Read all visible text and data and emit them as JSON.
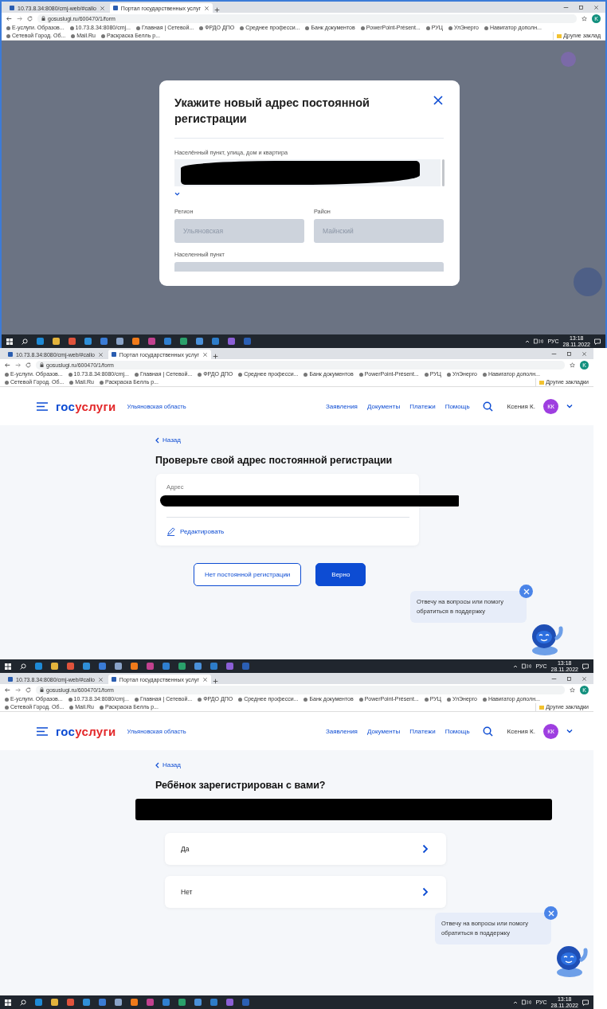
{
  "screens": [
    {
      "kind": "modal",
      "browser": {
        "tabs": [
          {
            "label": "10.73.8.34:8080/cmj-web/#callo",
            "selected": false
          },
          {
            "label": "Портал государственных услуг",
            "selected": true
          }
        ],
        "url": "gosuslugi.ru/600470/1/form",
        "profile_initial": "K",
        "bookmarks": [
          "Е-услуги. Образов...",
          "10.73.8.34:8080/cmj...",
          "Главная | Сетевой...",
          "ФРДО ДПО",
          "Среднее професси...",
          "Банк документов",
          "PowerPoint-Présent...",
          "РУЦ",
          "УлЭнерго",
          "Навигатор дополн...",
          "Сетевой Город. Об...",
          "Mail.Ru",
          "Раскраска Белль р..."
        ],
        "other_bookmarks": "Другие заклад"
      },
      "modal": {
        "title": "Укажите новый адрес постоянной регистрации",
        "address_label": "Населённый пункт, улица, дом и квартира",
        "fields": [
          {
            "label": "Регион",
            "value": "Ульяновская",
            "disabled": true
          },
          {
            "label": "Район",
            "value": "Майнский",
            "disabled": true
          }
        ],
        "locality_label": "Населенный пункт"
      },
      "taskbar": {
        "lang": "РУС",
        "time": "13:18",
        "date": "28.11.2022"
      }
    },
    {
      "kind": "address_check",
      "browser": {
        "tabs": [
          {
            "label": "10.73.8.34:8080/cmj-web/#callo",
            "selected": false
          },
          {
            "label": "Портал государственных услуг",
            "selected": true
          }
        ],
        "url": "gosuslugi.ru/600470/1/form",
        "profile_initial": "K",
        "bookmarks": [
          "Е-услуги. Образов...",
          "10.73.8.34:8080/cmj...",
          "Главная | Сетевой...",
          "ФРДО ДПО",
          "Среднее професси...",
          "Банк документов",
          "PowerPoint-Présent...",
          "РУЦ",
          "УлЭнерго",
          "Навигатор дополн...",
          "Сетевой Город. Об...",
          "Mail.Ru",
          "Раскраска Белль р..."
        ],
        "other_bookmarks": "Другие закладки"
      },
      "header": {
        "logo_part1": "гос",
        "logo_part2": "услуги",
        "region": "Ульяновская область",
        "nav": [
          "Заявления",
          "Документы",
          "Платежи",
          "Помощь"
        ],
        "user": "Ксения К.",
        "initials": "КК"
      },
      "back": "Назад",
      "title": "Проверьте свой адрес постоянной регистрации",
      "card_label": "Адрес",
      "edit": "Редактировать",
      "buttons": [
        {
          "label": "Нет постоянной регистрации",
          "kind": "secondary"
        },
        {
          "label": "Верно",
          "kind": "primary"
        }
      ],
      "chat": "Отвечу на вопросы или помогу обратиться в поддержку",
      "taskbar": {
        "lang": "РУС",
        "time": "13:18",
        "date": "28.11.2022"
      }
    },
    {
      "kind": "question",
      "browser": {
        "tabs": [
          {
            "label": "10.73.8.34:8080/cmj-web/#callo",
            "selected": false
          },
          {
            "label": "Портал государственных услуг",
            "selected": true
          }
        ],
        "url": "gosuslugi.ru/600470/1/form",
        "profile_initial": "K",
        "bookmarks": [
          "Е-услуги. Образов...",
          "10.73.8.34:8080/cmj...",
          "Главная | Сетевой...",
          "ФРДО ДПО",
          "Среднее професси...",
          "Банк документов",
          "PowerPoint-Présent...",
          "РУЦ",
          "УлЭнерго",
          "Навигатор дополн...",
          "Сетевой Город. Об...",
          "Mail.Ru",
          "Раскраска Белль р..."
        ],
        "other_bookmarks": "Другие закладки"
      },
      "header": {
        "logo_part1": "гос",
        "logo_part2": "услуги",
        "region": "Ульяновская область",
        "nav": [
          "Заявления",
          "Документы",
          "Платежи",
          "Помощь"
        ],
        "user": "Ксения К.",
        "initials": "КК"
      },
      "back": "Назад",
      "title": "Ребёнок зарегистрирован с вами?",
      "options": [
        "Да",
        "Нет"
      ],
      "chat": "Отвечу на вопросы или помогу обратиться в поддержку",
      "taskbar": {
        "lang": "РУС",
        "time": "13:18",
        "date": "28.11.2022"
      }
    }
  ]
}
